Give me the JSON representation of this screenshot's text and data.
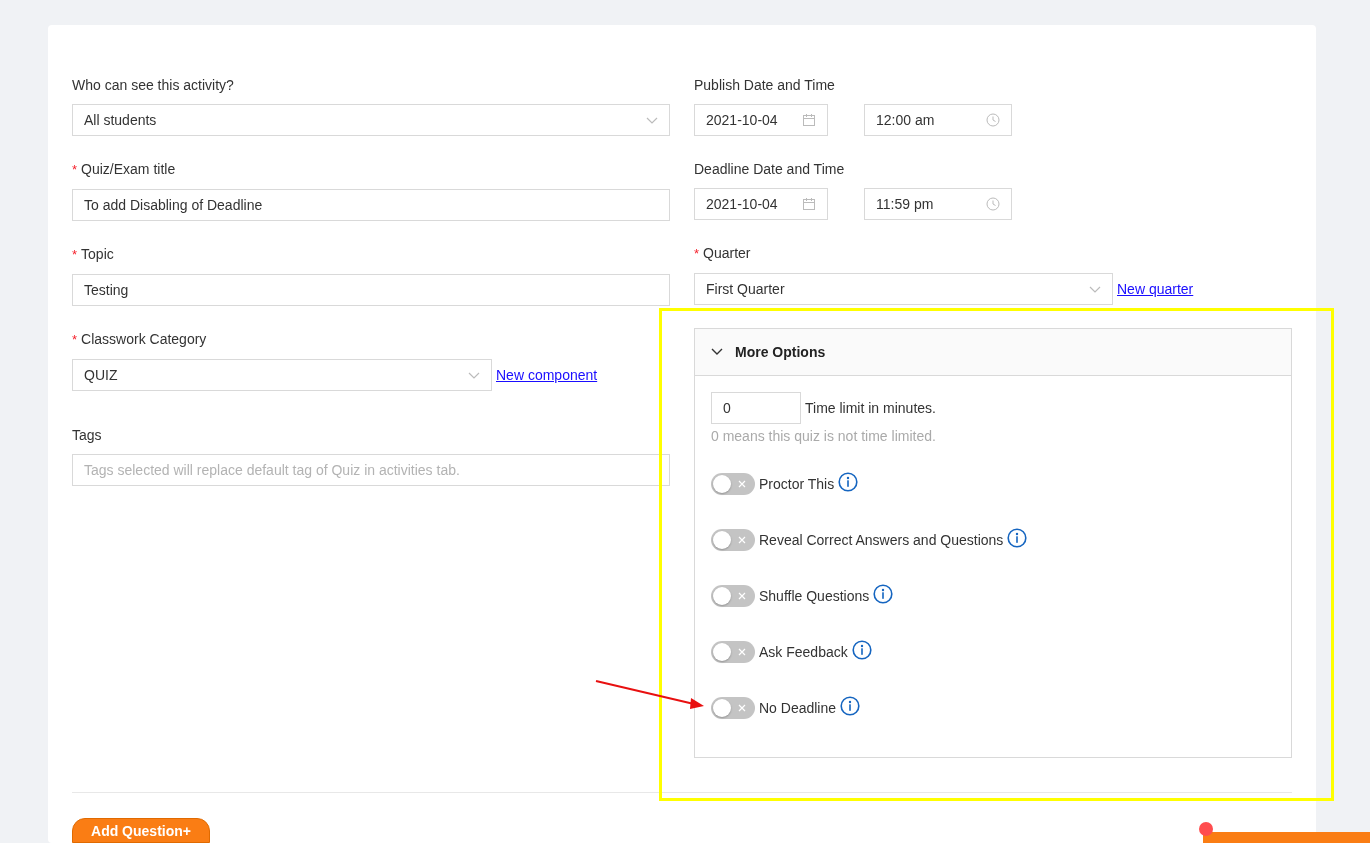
{
  "left_fields": [
    {
      "label": "Who can see this activity?",
      "kind": "select",
      "value": "All students"
    },
    {
      "label": "Quiz/Exam title",
      "required_mark": "*",
      "kind": "text",
      "value": "To add Disabling of Deadline"
    },
    {
      "label": "Topic",
      "required_mark": "*",
      "kind": "text",
      "value": "Testing"
    },
    {
      "label": "Classwork Category",
      "required_mark": "*",
      "kind": "select",
      "value": "QUIZ",
      "link": "New component"
    },
    {
      "label": "Tags",
      "kind": "tags",
      "placeholder": "Tags selected will replace default tag of Quiz in activities tab."
    }
  ],
  "right_fields": [
    {
      "label": "Publish Date and Time",
      "kind": "datetime",
      "date": "2021-10-04",
      "time": "12:00 am"
    },
    {
      "label": "Deadline Date and Time",
      "kind": "datetime",
      "date": "2021-10-04",
      "time": "11:59 pm"
    },
    {
      "label": "Quarter",
      "required_mark": "*",
      "kind": "select",
      "value": "First Quarter",
      "link": "New quarter"
    }
  ],
  "more_options": {
    "title": "More Options",
    "expanded": true,
    "time_limit": {
      "value": "0",
      "label": "Time limit in minutes.",
      "hint": "0 means this quiz is not time limited."
    },
    "toggles": [
      {
        "label": "Proctor This",
        "on": false
      },
      {
        "label": "Reveal Correct Answers and Questions",
        "on": false
      },
      {
        "label": "Shuffle Questions",
        "on": false
      },
      {
        "label": "Ask Feedback",
        "on": false
      },
      {
        "label": "No Deadline",
        "on": false
      }
    ]
  },
  "add_question_button": "Add Question+"
}
